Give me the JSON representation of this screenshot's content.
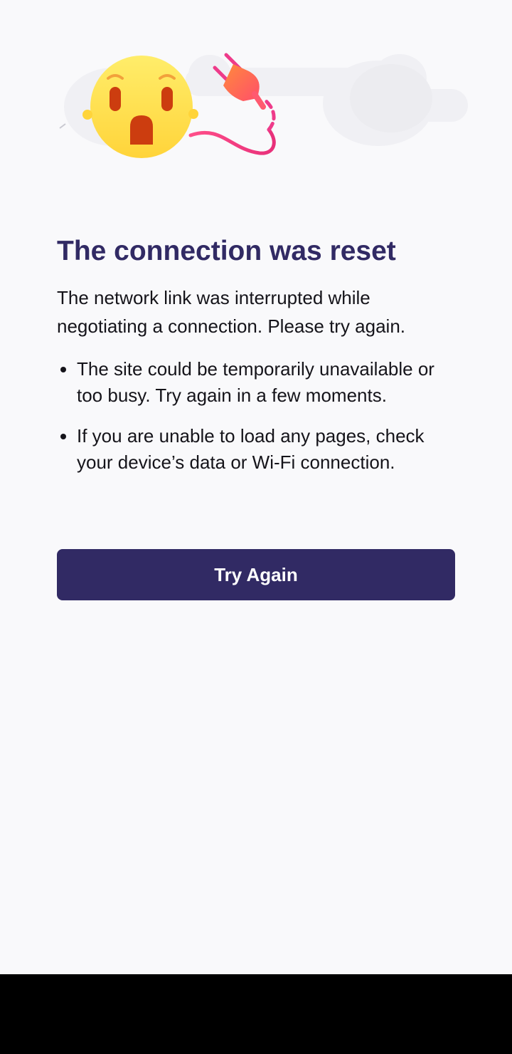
{
  "error_page": {
    "title": "The connection was reset",
    "description": "The network link was interrupted while negotiating a connection. Please try again.",
    "bullets": [
      "The site could be temporarily unavailable or too busy. Try again in a few moments.",
      "If you are unable to load any pages, check your device’s data or Wi-Fi connection."
    ],
    "button_label": "Try Again"
  },
  "illustration": {
    "icons": [
      "shocked-face-icon",
      "unplugged-plug-icon",
      "cloud-icon"
    ]
  },
  "colors": {
    "background": "#f9f9fb",
    "title": "#312a64",
    "text": "#15141a",
    "button": "#312a64",
    "button_text": "#ffffff",
    "face": "#ffe55b",
    "plug": "#ff6a50",
    "cord": "#ee3b8a",
    "nav_bar": "#000000"
  }
}
